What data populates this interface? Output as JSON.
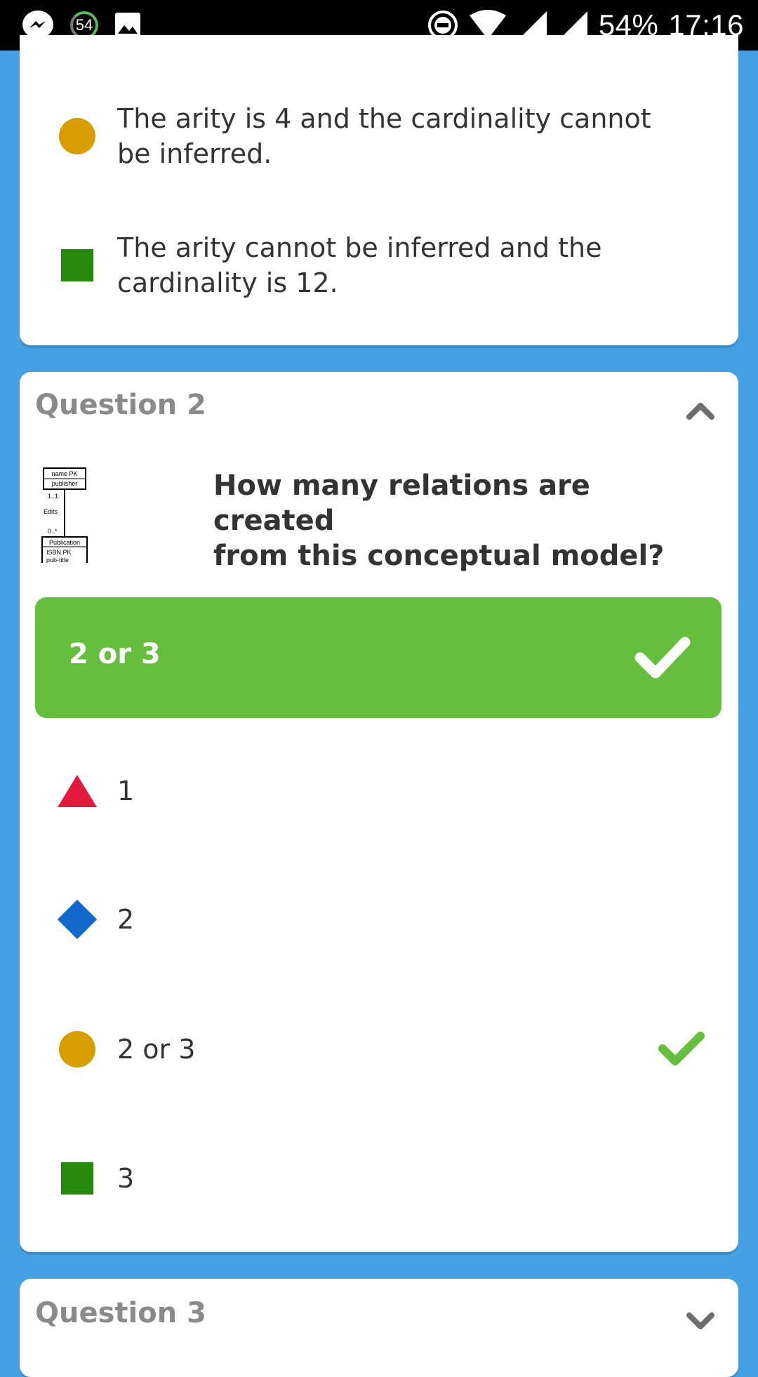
{
  "status_bar": {
    "notification_count": "54",
    "battery": "54%",
    "time": "17:16"
  },
  "top_card": {
    "options": [
      {
        "shape": "circle-icon",
        "color": "#d89e00",
        "text_line1": "The arity is 4 and the cardinality cannot",
        "text_line2": "be inferred."
      },
      {
        "shape": "square-icon",
        "color": "#26890c",
        "text_line1": "The arity cannot be inferred and the",
        "text_line2": "cardinality is 12."
      }
    ]
  },
  "question2": {
    "title": "Question 2",
    "text_line1": "How many relations are created",
    "text_line2": "from this conceptual model?",
    "thumbnail": {
      "box1_line1": "name PK",
      "box1_line2": "publisher",
      "mult1": "1..1",
      "relation": "Edits",
      "mult2": "0..*",
      "box2_line1": "Publication",
      "box2_line2": "ISBN PK",
      "box2_line3": "pub-title"
    },
    "correct_answer": "2 or 3",
    "options": [
      {
        "shape": "triangle-icon",
        "color": "#e21b3c",
        "text": "1"
      },
      {
        "shape": "diamond-icon",
        "color": "#1368ce",
        "text": "2"
      },
      {
        "shape": "circle-icon",
        "color": "#d89e00",
        "text": "2 or 3",
        "correct": true
      },
      {
        "shape": "square-icon",
        "color": "#26890c",
        "text": "3"
      }
    ],
    "colors": {
      "correct_green": "#66bf3c",
      "background_blue": "#46a0e4"
    }
  },
  "question3": {
    "title": "Question 3"
  }
}
